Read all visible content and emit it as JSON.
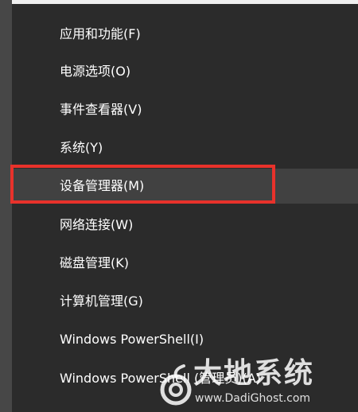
{
  "menu": {
    "items": [
      {
        "label": "应用和功能(F)"
      },
      {
        "label": "电源选项(O)"
      },
      {
        "label": "事件查看器(V)"
      },
      {
        "label": "系统(Y)"
      },
      {
        "label": "设备管理器(M)"
      },
      {
        "label": "网络连接(W)"
      },
      {
        "label": "磁盘管理(K)"
      },
      {
        "label": "计算机管理(G)"
      },
      {
        "label": "Windows PowerShell(I)"
      },
      {
        "label": "Windows PowerShell (管理员)(A)"
      }
    ],
    "highlighted_label": "设备管理器(M)"
  },
  "annotation": {
    "highlight_color": "#e8322b"
  },
  "watermark": {
    "title": "大地系统",
    "url": "www.DadiGhost.com"
  }
}
